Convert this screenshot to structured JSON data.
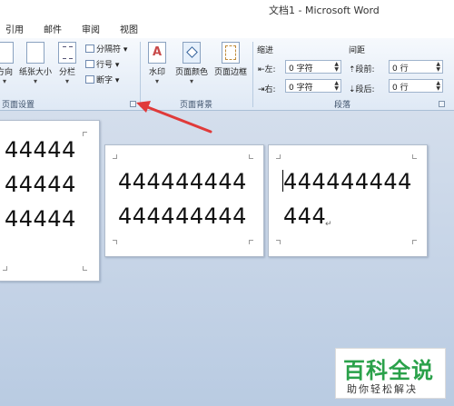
{
  "window": {
    "title": "文档1 - Microsoft Word"
  },
  "tabs": [
    "引用",
    "邮件",
    "审阅",
    "视图"
  ],
  "ribbon": {
    "page_setup": {
      "orientation_label": "方向",
      "size_label": "纸张大小",
      "columns_label": "分栏",
      "breaks_label": "分隔符",
      "line_numbers_label": "行号",
      "hyphenation_label": "断字",
      "group_label": "页面设置"
    },
    "page_background": {
      "watermark_label": "水印",
      "page_color_label": "页面颜色",
      "page_border_label": "页面边框",
      "group_label": "页面背景"
    },
    "paragraph": {
      "indent_title": "缩进",
      "spacing_title": "间距",
      "left_label": "左:",
      "left_value": "0 字符",
      "right_label": "右:",
      "right_value": "0 字符",
      "before_label": "段前:",
      "before_value": "0 行",
      "after_label": "段后:",
      "after_value": "0 行",
      "group_label": "段落"
    }
  },
  "document": {
    "page1_lines": [
      "44444",
      "44444",
      "44444"
    ],
    "page2_lines": [
      "444444444",
      "444444444"
    ],
    "page3_lines": [
      "444444444",
      "444"
    ]
  },
  "watermark": {
    "brand": "百科全说",
    "slogan": "助你轻松解决"
  },
  "colors": {
    "annotation_arrow": "#e03a3a",
    "brand_green": "#2aa14a"
  }
}
